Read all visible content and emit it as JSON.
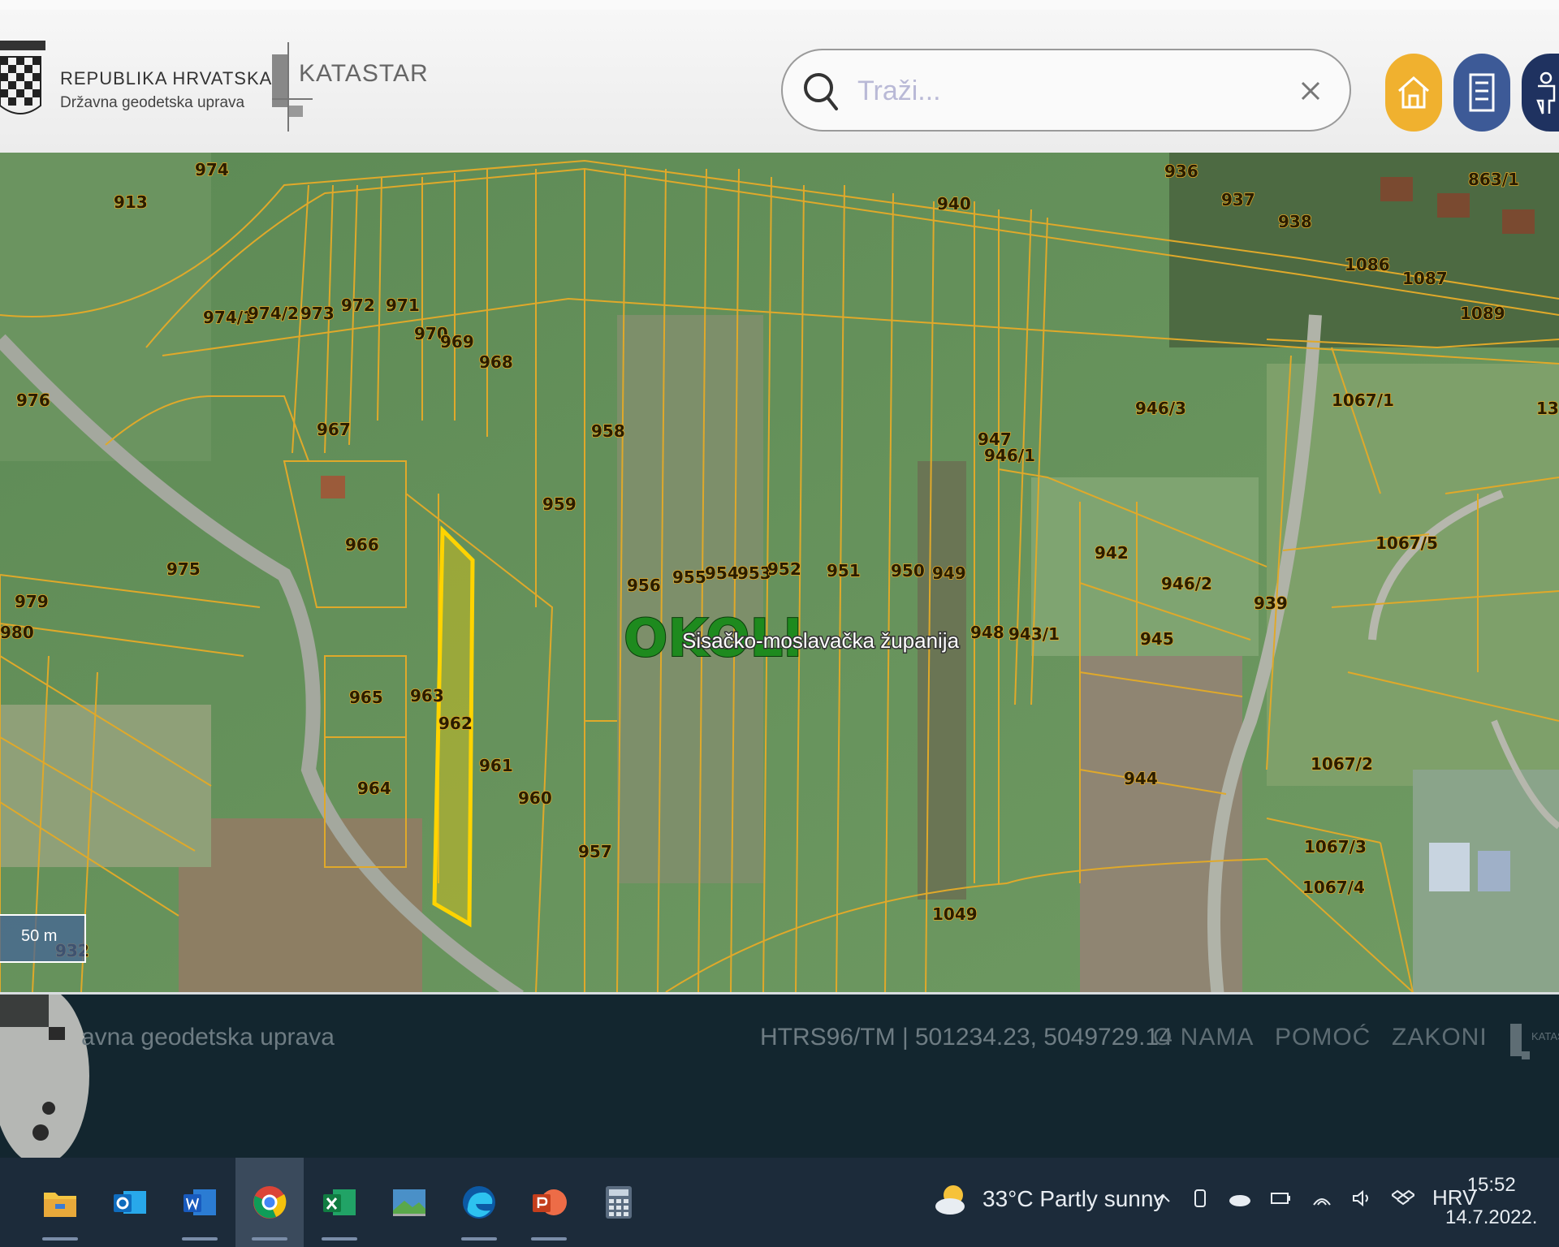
{
  "header": {
    "org_name": "REPUBLIKA HRVATSKA",
    "org_sub": "Državna geodetska uprava",
    "katastar": "KATASTAR",
    "search_placeholder": "Traži...",
    "buttons": {
      "home": "home-icon",
      "list": "list-icon",
      "user": "user-icon"
    }
  },
  "map": {
    "okoli_label": "OKOLI",
    "region_label": "Sisačko-moslavačka županija",
    "scale_label": "50 m",
    "parcels": [
      "974",
      "913",
      "974/1",
      "974/2",
      "973",
      "972",
      "971",
      "970",
      "969",
      "968",
      "976",
      "967",
      "958",
      "959",
      "966",
      "975",
      "979",
      "980",
      "965",
      "963",
      "962",
      "961",
      "960",
      "964",
      "957",
      "956",
      "955",
      "954",
      "953",
      "952",
      "951",
      "950",
      "949",
      "948",
      "947",
      "946/1",
      "946/3",
      "943/1",
      "942",
      "946/2",
      "945",
      "944",
      "939",
      "940",
      "936",
      "937",
      "938",
      "1086",
      "1087",
      "1089",
      "863/1",
      "1067/1",
      "1067/5",
      "1067/2",
      "1067/3",
      "1067/4",
      "1049",
      "932",
      "13"
    ]
  },
  "footer": {
    "org": "avna geodetska uprava",
    "crs": "HTRS96/TM |",
    "coords": "501234.23, 5049729.14",
    "links": [
      "O NAMA",
      "POMOĆ",
      "ZAKONI"
    ],
    "logo_text": "KATAS"
  },
  "taskbar": {
    "apps": [
      "file-explorer-icon",
      "outlook-icon",
      "word-icon",
      "chrome-icon",
      "excel-icon",
      "photos-icon",
      "edge-icon",
      "powerpoint-icon",
      "calculator-icon"
    ],
    "weather": "33°C  Partly sunny",
    "lang": "HRV",
    "time": "15:52",
    "date": "14.7.2022."
  },
  "colors": {
    "parcel_line": "#e0a92a",
    "selected": "#ffd400",
    "accent_home": "#f0b12f"
  }
}
